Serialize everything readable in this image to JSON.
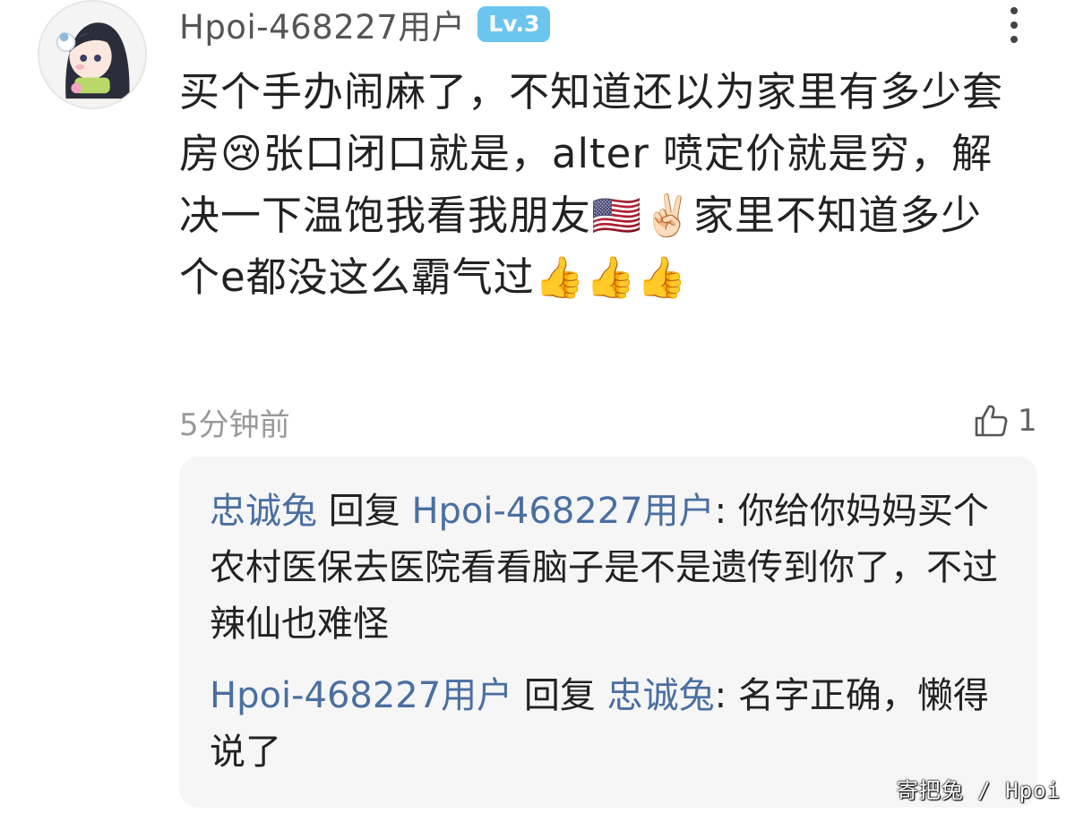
{
  "comment": {
    "username": "Hpoi-468227用户",
    "level": "Lv.3",
    "body": "买个手办闹麻了，不知道还以为家里有多少套房😢张口闭口就是，alter 喷定价就是穷，解决一下温饱我看我朋友🇺🇸✌🏻家里不知道多少个e都没这么霸气过👍👍👍",
    "time": "5分钟前",
    "like_count": "1"
  },
  "replies": [
    {
      "author": "忠诚兔",
      "reply_word": " 回复 ",
      "target": "Hpoi-468227用户",
      "colon": ": ",
      "text": "你给你妈妈买个农村医保去医院看看脑子是不是遗传到你了，不过辣仙也难怪"
    },
    {
      "author": "Hpoi-468227用户",
      "reply_word": " 回复 ",
      "target": "忠诚兔",
      "colon": ": ",
      "text": "名字正确，懒得说了"
    }
  ],
  "watermark": "寄把兔 / Hpoi",
  "colors": {
    "link": "#4a6fa1",
    "badge": "#6cc5ef",
    "reply_bg": "#f6f6f7"
  },
  "icons": {
    "more": "more-vertical-icon",
    "like": "thumbs-up-icon"
  }
}
